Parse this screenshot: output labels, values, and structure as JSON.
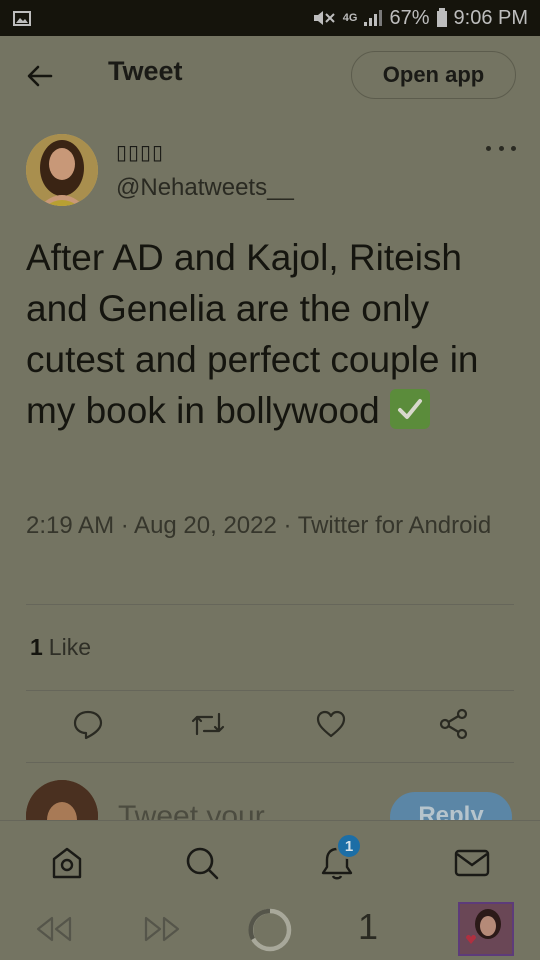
{
  "status_bar": {
    "network": "4G",
    "battery": "67%",
    "time": "9:06 PM"
  },
  "header": {
    "title": "Tweet",
    "open_app_label": "Open app"
  },
  "tweet": {
    "display_name": "▯▯▯▯",
    "handle": "@Nehatweets__",
    "text": "After AD and Kajol, Riteish and Genelia  are the only cutest and perfect couple in my book in bollywood",
    "emoji": "check-mark-emoji",
    "meta": "2:19 AM · Aug 20, 2022 · Twitter for Android",
    "likes_count": "1",
    "likes_label": "Like"
  },
  "reply": {
    "placeholder": "Tweet your",
    "button_label": "Reply"
  },
  "nav": {
    "notifications_badge": "1"
  },
  "browser": {
    "tab_count": "1"
  },
  "colors": {
    "background": "#747462",
    "status_bar": "#15140c",
    "badge": "#1c6ea6",
    "reply_button": "#5b86a6",
    "check_emoji": "#5b8c3b"
  }
}
